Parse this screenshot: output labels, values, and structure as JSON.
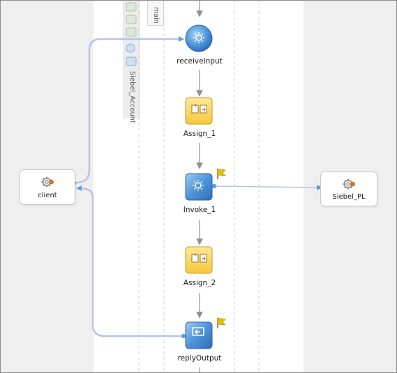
{
  "scope": {
    "name": "Siebel_Account",
    "sequence": "main"
  },
  "partner_links": {
    "client": {
      "label": "client",
      "icon": "gear-icon"
    },
    "siebel": {
      "label": "Siebel_PL",
      "icon": "gear-icon"
    }
  },
  "activities": {
    "receive": {
      "label": "receiveInput",
      "icon": "receive-gear-icon"
    },
    "assign1": {
      "label": "Assign_1",
      "icon": "assign-icon"
    },
    "invoke": {
      "label": "Invoke_1",
      "icon": "invoke-gear-icon",
      "flagged": true
    },
    "assign2": {
      "label": "Assign_2",
      "icon": "assign-icon"
    },
    "reply": {
      "label": "replyOutput",
      "icon": "reply-icon",
      "flagged": true
    }
  },
  "colors": {
    "connector": "#b9c2ee",
    "sequence_arrow": "#8f8f8f",
    "assign_fill": "#fcd86a",
    "invoke_fill": "#5b9ad6",
    "receive_fill": "#5ea3e0",
    "flag": "#e8c000"
  }
}
